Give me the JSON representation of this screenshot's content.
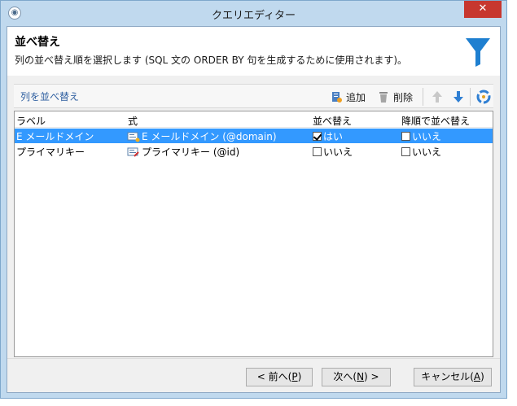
{
  "window": {
    "title": "クエリエディター",
    "close_glyph": "✕"
  },
  "header": {
    "title": "並べ替え",
    "description": "列の並べ替え順を選択します (SQL 文の ORDER BY 句を生成するために使用されます)。"
  },
  "toolbar": {
    "section_label": "列を並べ替え",
    "add_label": "追加",
    "delete_label": "削除"
  },
  "grid": {
    "columns": {
      "label": "ラベル",
      "expression": "式",
      "sort": "並べ替え",
      "descending": "降順で並べ替え"
    },
    "rows": [
      {
        "label": "E メールドメイン",
        "expression": "E メールドメイン (@domain)",
        "sort": "はい",
        "sort_checked": true,
        "descending": "いいえ",
        "descending_checked": false,
        "selected": true
      },
      {
        "label": "プライマリキー",
        "expression": "プライマリキー (@id)",
        "sort": "いいえ",
        "sort_checked": false,
        "descending": "いいえ",
        "descending_checked": false,
        "selected": false
      }
    ]
  },
  "buttons": {
    "prev": {
      "label": "< 前へ(",
      "key": "P",
      "suffix": ")"
    },
    "next": {
      "label": "次へ(",
      "key": "N",
      "suffix": ") >"
    },
    "cancel": {
      "label": "キャンセル(",
      "key": "A",
      "suffix": ")"
    }
  },
  "colors": {
    "accent": "#3399ff",
    "funnel": "#1e7fd0",
    "titlebar": "#c0d9ee",
    "close": "#c7372f"
  }
}
